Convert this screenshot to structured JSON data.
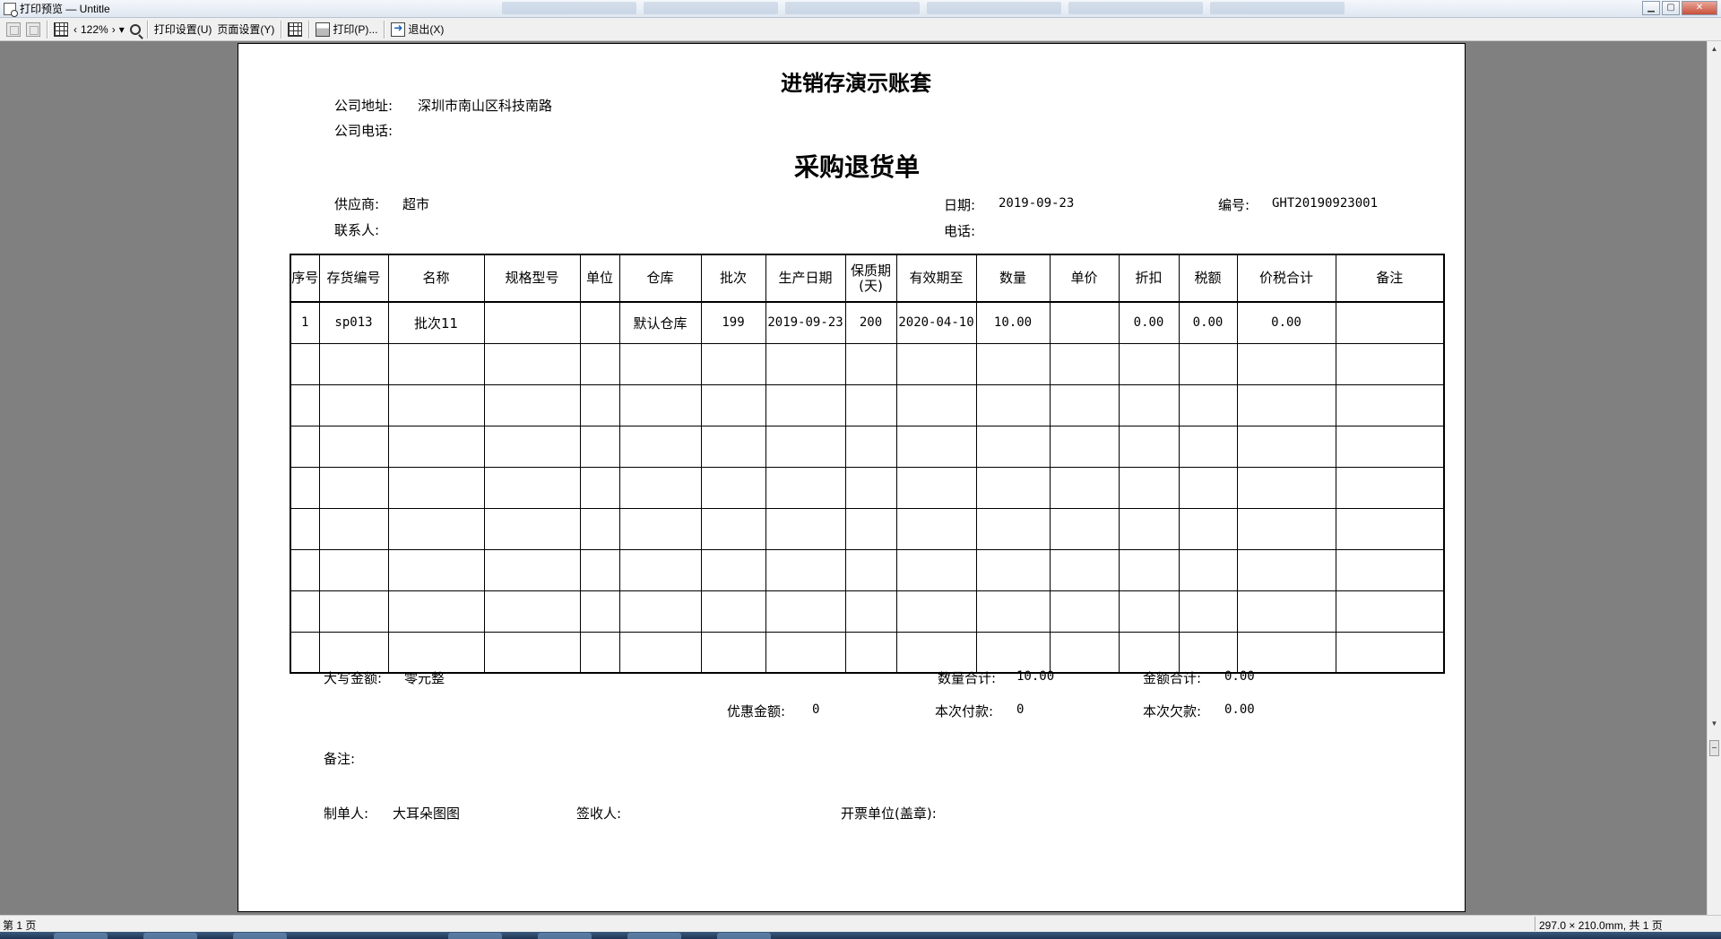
{
  "window": {
    "title": "打印预览 — Untitle"
  },
  "toolbar": {
    "zoom": "122%",
    "print_settings": "打印设置(U)",
    "page_settings": "页面设置(Y)",
    "print": "打印(P)...",
    "exit": "退出(X)"
  },
  "document": {
    "company_name": "进销存演示账套",
    "address_label": "公司地址:",
    "address_value": "深圳市南山区科技南路",
    "phone_label": "公司电话:",
    "title": "采购退货单",
    "supplier_label": "供应商:",
    "supplier_value": "超市",
    "contact_label": "联系人:",
    "date_label": "日期:",
    "date_value": "2019-09-23",
    "tel_label": "电话:",
    "number_label": "编号:",
    "number_value": "GHT20190923001",
    "table": {
      "headers": [
        "序号",
        "存货编号",
        "名称",
        "规格型号",
        "单位",
        "仓库",
        "批次",
        "生产日期",
        "保质期(天)",
        "有效期至",
        "数量",
        "单价",
        "折扣",
        "税额",
        "价税合计",
        "备注"
      ],
      "rows": [
        [
          "1",
          "sp013",
          "批次11",
          "",
          "",
          "默认仓库",
          "199",
          "2019-09-23",
          "200",
          "2020-04-10",
          "10.00",
          "",
          "0.00",
          "0.00",
          "0.00",
          ""
        ]
      ]
    },
    "amount_words_label": "大写金额:",
    "amount_words_value": "零元整",
    "qty_total_label": "数量合计:",
    "qty_total_value": "10.00",
    "amount_total_label": "金额合计:",
    "amount_total_value": "0.00",
    "discount_label": "优惠金额:",
    "discount_value": "0",
    "paid_label": "本次付款:",
    "paid_value": "0",
    "owed_label": "本次欠款:",
    "owed_value": "0.00",
    "remark_label": "备注:",
    "maker_label": "制单人:",
    "maker_value": "大耳朵图图",
    "signer_label": "签收人:",
    "issuer_label": "开票单位(盖章):"
  },
  "status": {
    "page": "第 1 页",
    "paper": "297.0 × 210.0mm, 共 1 页"
  }
}
